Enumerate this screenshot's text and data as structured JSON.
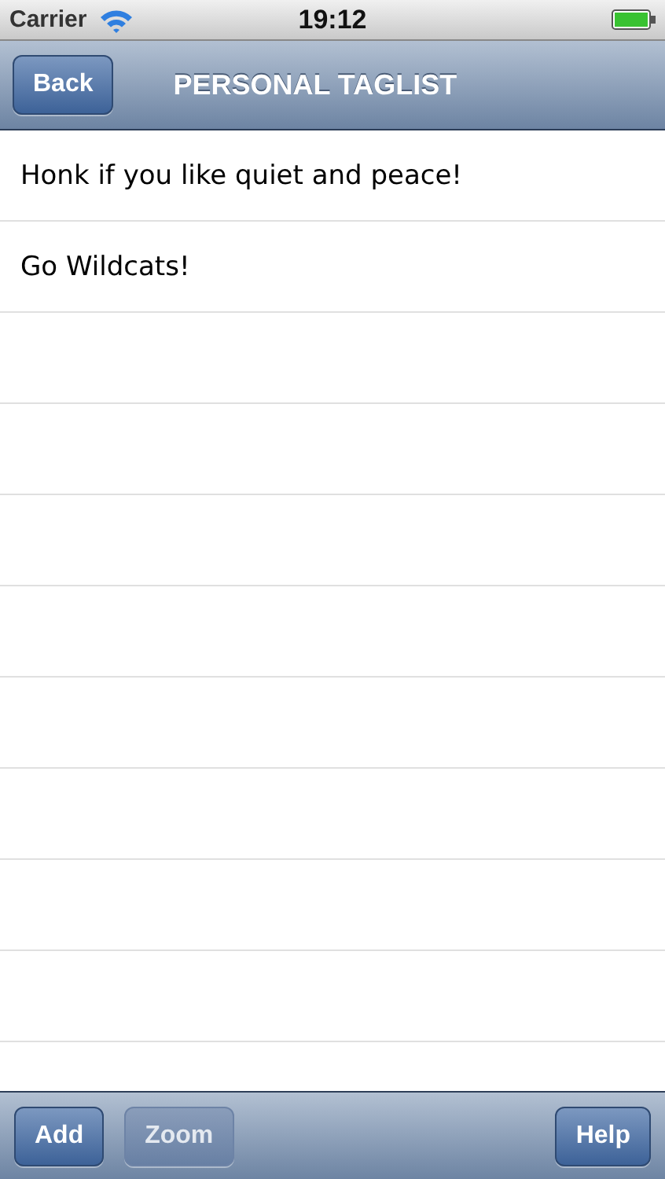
{
  "status_bar": {
    "carrier": "Carrier",
    "time": "19:12"
  },
  "nav_bar": {
    "back": "Back",
    "title": "PERSONAL TAGLIST"
  },
  "tags": [
    "Honk if you like quiet and peace!",
    "Go Wildcats!"
  ],
  "toolbar": {
    "left": [
      {
        "label": "Add",
        "disabled": false
      },
      {
        "label": "Zoom",
        "disabled": true
      }
    ],
    "right": [
      {
        "label": "Help",
        "disabled": false
      }
    ]
  }
}
